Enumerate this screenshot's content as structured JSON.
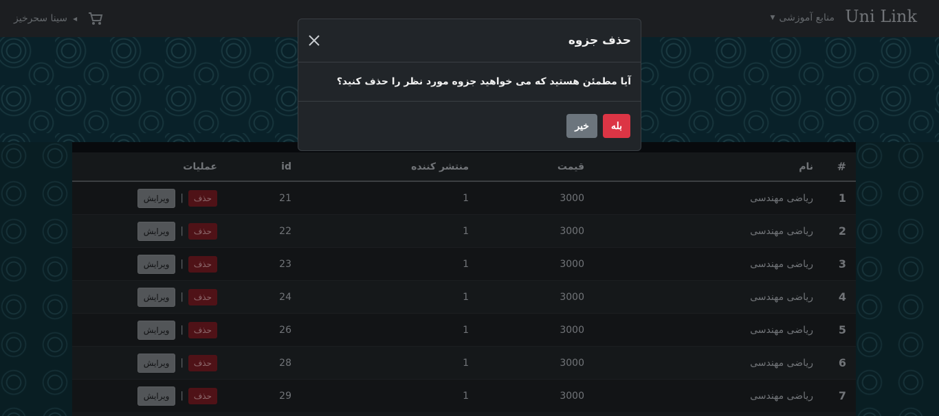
{
  "navbar": {
    "brand": "Uni Link",
    "menu_label": "منابع آموزشی",
    "user_name": "سینا سحرخیز"
  },
  "table": {
    "headers": {
      "index": "#",
      "name": "نام",
      "price": "قیمت",
      "publisher": "منتشر کننده",
      "id": "id",
      "operations": "عملیات"
    },
    "delete_label": "حذف",
    "edit_label": "ویرایش",
    "separator": "|",
    "rows": [
      {
        "index": "1",
        "name": "ریاضی مهندسی",
        "price": "3000",
        "publisher": "1",
        "id": "21"
      },
      {
        "index": "2",
        "name": "ریاضی مهندسی",
        "price": "3000",
        "publisher": "1",
        "id": "22"
      },
      {
        "index": "3",
        "name": "ریاضی مهندسی",
        "price": "3000",
        "publisher": "1",
        "id": "23"
      },
      {
        "index": "4",
        "name": "ریاضی مهندسی",
        "price": "3000",
        "publisher": "1",
        "id": "24"
      },
      {
        "index": "5",
        "name": "ریاضی مهندسی",
        "price": "3000",
        "publisher": "1",
        "id": "26"
      },
      {
        "index": "6",
        "name": "ریاضی مهندسی",
        "price": "3000",
        "publisher": "1",
        "id": "28"
      },
      {
        "index": "7",
        "name": "ریاضی مهندسی",
        "price": "3000",
        "publisher": "1",
        "id": "29"
      }
    ]
  },
  "modal": {
    "title": "حذف جزوه",
    "message": "آیا مطمئن هستید که می خواهید جزوه مورد نظر را حذف کنید؟",
    "yes_label": "بله",
    "no_label": "خیر"
  },
  "colors": {
    "danger": "#dc3545",
    "secondary": "#6c757d",
    "navbar": "#2c2f33"
  }
}
